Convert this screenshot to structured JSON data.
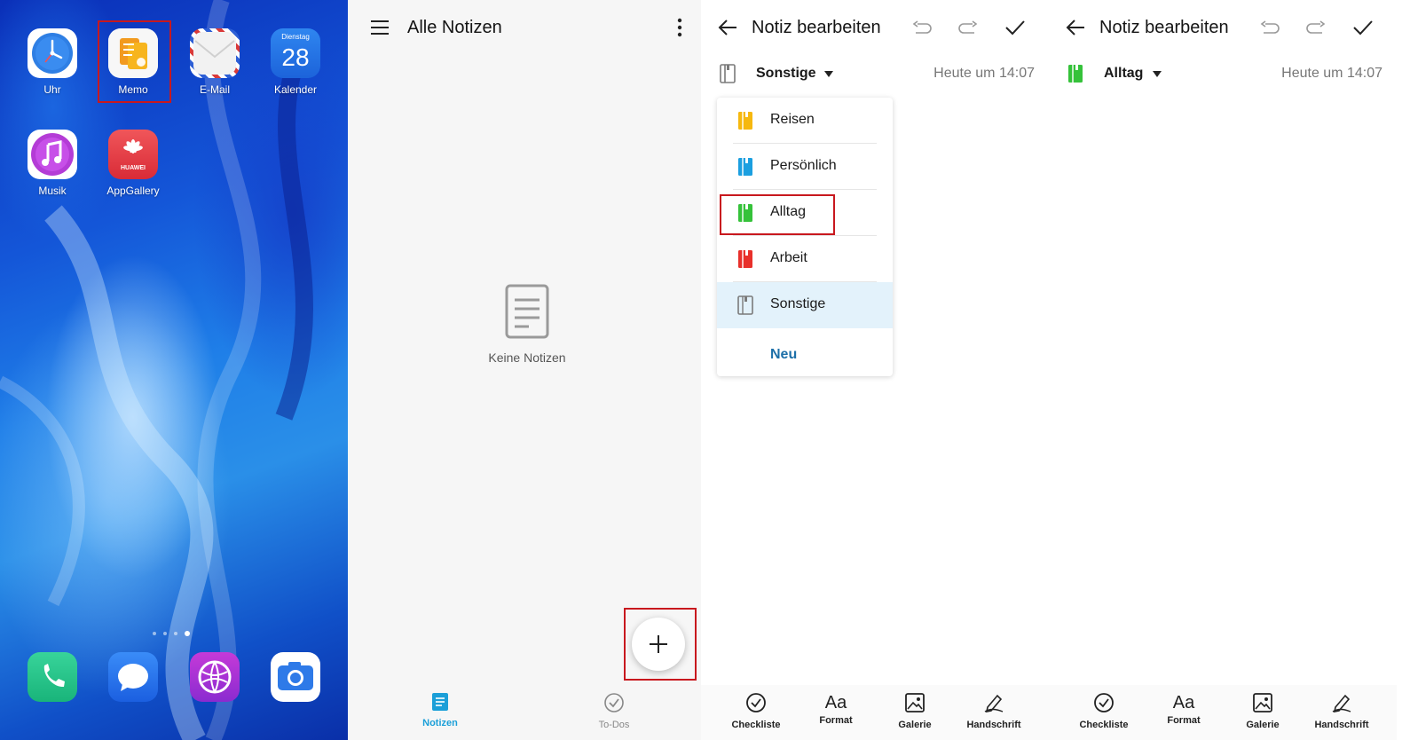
{
  "home": {
    "apps": [
      {
        "label": "Uhr",
        "icon": "clock-icon"
      },
      {
        "label": "Memo",
        "icon": "memo-icon"
      },
      {
        "label": "E-Mail",
        "icon": "mail-icon"
      },
      {
        "label": "Kalender",
        "icon": "calendar-icon",
        "weekday": "Dienstag",
        "day": "28"
      },
      {
        "label": "Musik",
        "icon": "music-icon"
      },
      {
        "label": "AppGallery",
        "icon": "appgallery-icon",
        "brand": "HUAWEI"
      }
    ],
    "dock": [
      {
        "icon": "phone-icon"
      },
      {
        "icon": "messages-icon"
      },
      {
        "icon": "browser-icon"
      },
      {
        "icon": "camera-icon"
      }
    ],
    "highlight_color": "#c8181e"
  },
  "notes": {
    "title": "Alle Notizen",
    "empty_text": "Keine Notizen",
    "fab_icon": "plus-icon",
    "nav": [
      {
        "label": "Notizen",
        "icon": "note-icon",
        "active": true
      },
      {
        "label": "To-Dos",
        "icon": "check-circle-icon",
        "active": false
      }
    ],
    "accent": "#1b9fd8"
  },
  "editor1": {
    "title": "Notiz bearbeiten",
    "category": "Sonstige",
    "time": "Heute um 14:07",
    "dropdown": {
      "items": [
        {
          "label": "Reisen",
          "color": "#f6b80f"
        },
        {
          "label": "Persönlich",
          "color": "#1b9fe0"
        },
        {
          "label": "Alltag",
          "color": "#35c23a"
        },
        {
          "label": "Arbeit",
          "color": "#e8302b"
        },
        {
          "label": "Sonstige",
          "color": "#8a8a8a",
          "selected": true
        }
      ],
      "new_label": "Neu"
    },
    "tools": [
      "Checkliste",
      "Format",
      "Galerie",
      "Handschrift"
    ]
  },
  "editor2": {
    "title": "Notiz bearbeiten",
    "category": "Alltag",
    "category_color": "#35c23a",
    "time": "Heute um 14:07",
    "tools": [
      "Checkliste",
      "Format",
      "Galerie",
      "Handschrift"
    ]
  }
}
